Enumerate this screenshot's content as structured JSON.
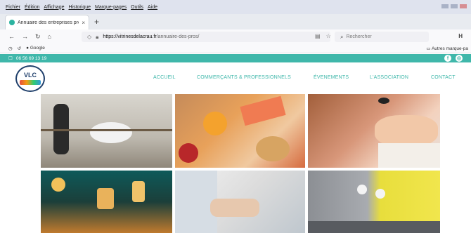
{
  "browser": {
    "menu": [
      "Fichier",
      "Édition",
      "Affichage",
      "Historique",
      "Marque-pages",
      "Outils",
      "Aide"
    ],
    "tab_title": "Annuaire des entreprises profe",
    "tab_close": "×",
    "new_tab": "+",
    "url_domain": "https://vitrinesdelacrau.fr",
    "url_path": "/annuaire-des-pros/",
    "search_placeholder": "Rechercher",
    "bookmarks": [
      "Google"
    ],
    "other_bookmarks": "Autres marque-pa"
  },
  "site": {
    "phone": "06 56 69 13 19",
    "logo_text": "VLC",
    "menu": [
      "ACCUEIL",
      "COMMERÇANTS & PROFESSIONNELS",
      "ÉVENEMENTS",
      "L'ASSOCIATION",
      "CONTACT"
    ],
    "accent_color": "#3fb7aa"
  },
  "icons": [
    "back-icon",
    "forward-icon",
    "reload-icon",
    "home-icon",
    "shield-icon",
    "lock-icon",
    "reader-icon",
    "star-icon",
    "search-icon",
    "history-icon",
    "sync-icon",
    "facebook-icon",
    "instagram-icon",
    "phone-icon",
    "folder-icon"
  ]
}
